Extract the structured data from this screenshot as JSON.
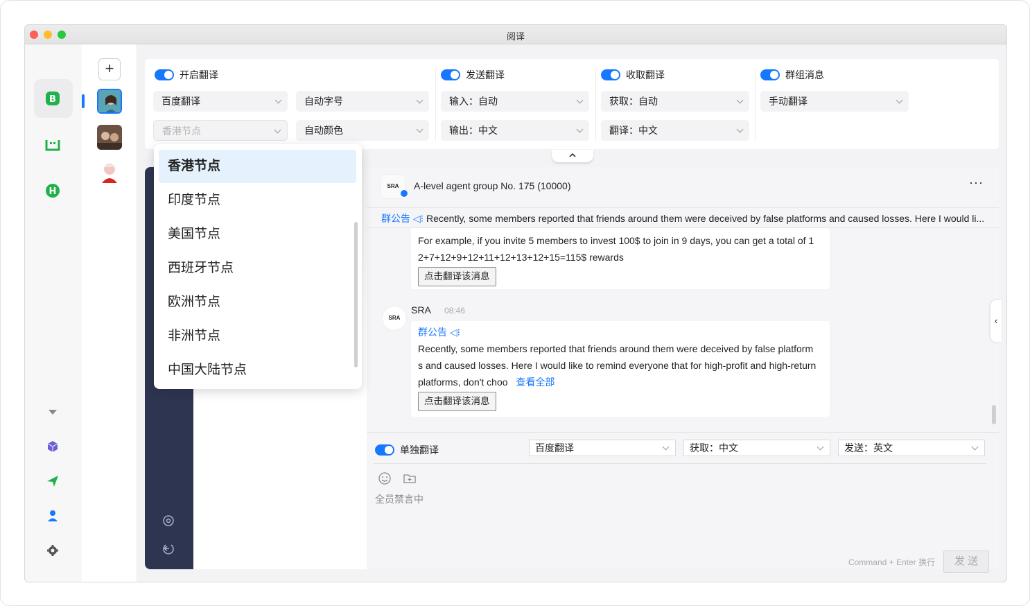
{
  "window": {
    "title": "阅译"
  },
  "accounts": {
    "add_label": "+"
  },
  "settings": {
    "enable_translate": {
      "label": "开启翻译",
      "engine": "百度翻译",
      "font_size": "自动字号",
      "node_placeholder": "香港节点",
      "color": "自动颜色"
    },
    "send_translate": {
      "label": "发送翻译",
      "input": "输入：自动",
      "output": "输出：中文"
    },
    "receive_translate": {
      "label": "收取翻译",
      "fetch": "获取：自动",
      "translate": "翻译：中文"
    },
    "group_messages": {
      "label": "群组消息",
      "mode": "手动翻译"
    }
  },
  "node_dropdown": {
    "options": [
      "香港节点",
      "印度节点",
      "美国节点",
      "西班牙节点",
      "欧洲节点",
      "非洲节点",
      "中国大陆节点"
    ],
    "selected": "香港节点"
  },
  "chat": {
    "group_name": "A-level agent group No. 175  (10000)",
    "avatar_text": "SRA",
    "more_label": "···",
    "notice_label": "群公告",
    "notice_text": "Recently, some members reported that friends around them were deceived by false platforms and caused losses. Here I would li...",
    "messages": [
      {
        "line1": "For example, if you invite 5 members to invest 100$ to join in 9 days, you can get a total of 1",
        "line2": "2+7+12+9+12+11+12+13+12+15=115$ rewards",
        "translate_button": "点击翻译该消息"
      },
      {
        "sender": "SRA",
        "time": "08:46",
        "notice_label": "群公告",
        "line1": "Recently, some members reported that friends around them were deceived by false platform",
        "line2": "s and caused losses. Here I would like to remind everyone that for high-profit and high-return",
        "line3": "platforms, don't choo",
        "view_all": "查看全部",
        "translate_button": "点击翻译该消息"
      }
    ]
  },
  "composer": {
    "single_translate_label": "单独翻译",
    "engine": "百度翻译",
    "fetch": "获取：中文",
    "send_lang": "发送：英文",
    "muted_text": "全员禁言中",
    "hint": "Command + Enter 换行",
    "send_label": "发 送"
  },
  "colors": {
    "accent": "#1677ff",
    "green": "#20b24a",
    "dark_sidebar": "#2e3550"
  }
}
